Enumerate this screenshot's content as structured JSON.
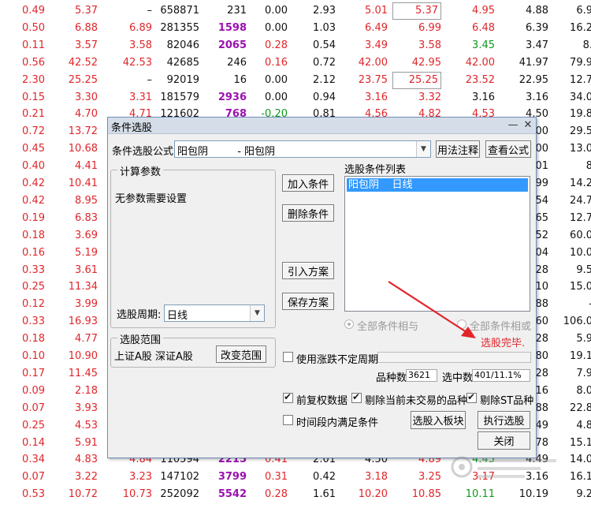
{
  "stock_rows": [
    [
      "0.49",
      "5.37",
      "–",
      "658871",
      "231",
      "0.00",
      "2.93",
      "5.01",
      "5.37",
      "4.95",
      "4.88",
      "6.9"
    ],
    [
      "0.50",
      "6.88",
      "6.89",
      "281355",
      "1598",
      "0.00",
      "1.03",
      "6.49",
      "6.99",
      "6.48",
      "6.39",
      "16.2"
    ],
    [
      "0.11",
      "3.57",
      "3.58",
      "82046",
      "2065",
      "0.28",
      "0.54",
      "3.49",
      "3.58",
      "3.45",
      "3.47",
      "8."
    ],
    [
      "0.56",
      "42.52",
      "42.53",
      "42685",
      "246",
      "0.16",
      "0.72",
      "42.00",
      "42.95",
      "42.00",
      "41.97",
      "79.9"
    ],
    [
      "2.30",
      "25.25",
      "–",
      "92019",
      "16",
      "0.00",
      "2.12",
      "23.75",
      "25.25",
      "23.52",
      "22.95",
      "12.7"
    ],
    [
      "0.15",
      "3.30",
      "3.31",
      "181579",
      "2936",
      "0.00",
      "0.94",
      "3.16",
      "3.32",
      "3.16",
      "3.16",
      "34.0"
    ],
    [
      "0.21",
      "4.70",
      "4.71",
      "121602",
      "768",
      "-0.20",
      "0.81",
      "4.56",
      "4.82",
      "4.53",
      "4.50",
      "19.8"
    ],
    [
      "0.72",
      "13.72",
      "",
      "",
      "",
      "",
      "",
      "",
      "",
      "",
      "00",
      "29.5"
    ],
    [
      "0.45",
      "10.68",
      "",
      "",
      "",
      "",
      "",
      "",
      "",
      "",
      "00",
      "13.0"
    ],
    [
      "0.40",
      "4.41",
      "",
      "",
      "",
      "",
      "",
      "",
      "",
      "",
      "01",
      "8"
    ],
    [
      "0.42",
      "10.41",
      "",
      "",
      "",
      "",
      "",
      "",
      "",
      "",
      "99",
      "14.2"
    ],
    [
      "0.42",
      "8.95",
      "",
      "",
      "",
      "",
      "",
      "",
      "",
      "",
      "54",
      "24.7"
    ],
    [
      "0.19",
      "6.83",
      "",
      "",
      "",
      "",
      "",
      "",
      "",
      "",
      "65",
      "12.7"
    ],
    [
      "0.18",
      "3.69",
      "",
      "",
      "",
      "",
      "",
      "",
      "",
      "",
      "52",
      "60.0"
    ],
    [
      "0.16",
      "5.19",
      "",
      "",
      "",
      "",
      "",
      "",
      "",
      "",
      "04",
      "10.0"
    ],
    [
      "0.33",
      "3.61",
      "",
      "",
      "",
      "",
      "",
      "",
      "",
      "",
      "28",
      "9.5"
    ],
    [
      "0.25",
      "11.34",
      "",
      "",
      "",
      "",
      "",
      "",
      "",
      "",
      "10",
      "15.0"
    ],
    [
      "0.12",
      "3.99",
      "",
      "",
      "",
      "",
      "",
      "",
      "",
      "",
      "88",
      "-"
    ],
    [
      "0.33",
      "16.93",
      "",
      "",
      "",
      "",
      "",
      "",
      "",
      "",
      "60",
      "106.0"
    ],
    [
      "0.18",
      "4.77",
      "",
      "",
      "",
      "",
      "",
      "",
      "",
      "",
      "28",
      "5.9"
    ],
    [
      "0.10",
      "10.90",
      "",
      "",
      "",
      "",
      "",
      "",
      "",
      "",
      "80",
      "19.1"
    ],
    [
      "0.17",
      "11.45",
      "",
      "",
      "",
      "",
      "",
      "",
      "",
      "",
      "28",
      "7.9"
    ],
    [
      "0.09",
      "2.18",
      "",
      "",
      "",
      "",
      "",
      "",
      "",
      "",
      "16",
      "8.0"
    ],
    [
      "0.07",
      "3.93",
      "",
      "",
      "",
      "",
      "",
      "",
      "",
      "",
      "88",
      "22.8"
    ],
    [
      "0.25",
      "4.53",
      "",
      "",
      "",
      "",
      "",
      "",
      "",
      "",
      "49",
      "4.8"
    ],
    [
      "0.14",
      "5.91",
      "",
      "",
      "",
      "",
      "",
      "",
      "",
      "",
      "78",
      "15.1"
    ],
    [
      "0.34",
      "4.83",
      "4.84",
      "110594",
      "2215",
      "0.41",
      "2.01",
      "4.50",
      "4.89",
      "4.45",
      "4.49",
      "14.0"
    ],
    [
      "0.07",
      "3.22",
      "3.23",
      "147102",
      "3799",
      "0.31",
      "0.42",
      "3.18",
      "3.25",
      "3.17",
      "3.16",
      "16.1"
    ],
    [
      "0.53",
      "10.72",
      "10.73",
      "252092",
      "5542",
      "0.28",
      "1.61",
      "10.20",
      "10.85",
      "10.11",
      "10.19",
      "9.2"
    ]
  ],
  "stock_colors": [
    [
      "red",
      "red",
      "black",
      "black",
      "black",
      "black",
      "black",
      "red",
      "red",
      "red",
      "black",
      "black"
    ],
    [
      "red",
      "red",
      "red",
      "black",
      "purple",
      "black",
      "black",
      "red",
      "red",
      "red",
      "black",
      "black"
    ],
    [
      "red",
      "red",
      "red",
      "black",
      "purple",
      "red",
      "black",
      "red",
      "red",
      "green",
      "black",
      "black"
    ],
    [
      "red",
      "red",
      "red",
      "black",
      "black",
      "red",
      "black",
      "red",
      "red",
      "red",
      "black",
      "black"
    ],
    [
      "red",
      "red",
      "black",
      "black",
      "black",
      "black",
      "black",
      "red",
      "red",
      "red",
      "black",
      "black"
    ],
    [
      "red",
      "red",
      "red",
      "black",
      "purple",
      "black",
      "black",
      "red",
      "red",
      "black",
      "black",
      "black"
    ],
    [
      "red",
      "red",
      "red",
      "black",
      "purple",
      "green",
      "black",
      "red",
      "red",
      "red",
      "black",
      "black"
    ],
    [
      "red",
      "red",
      "red",
      "black",
      "black",
      "black",
      "black",
      "black",
      "black",
      "black",
      "black",
      "black"
    ],
    [
      "red",
      "red",
      "red",
      "black",
      "black",
      "black",
      "black",
      "black",
      "black",
      "black",
      "black",
      "black"
    ],
    [
      "red",
      "red",
      "red",
      "black",
      "black",
      "black",
      "black",
      "black",
      "black",
      "black",
      "black",
      "black"
    ],
    [
      "red",
      "red",
      "red",
      "black",
      "black",
      "black",
      "black",
      "black",
      "black",
      "black",
      "black",
      "black"
    ],
    [
      "red",
      "red",
      "red",
      "black",
      "black",
      "black",
      "black",
      "black",
      "black",
      "black",
      "black",
      "black"
    ],
    [
      "red",
      "red",
      "red",
      "black",
      "black",
      "black",
      "black",
      "black",
      "black",
      "black",
      "black",
      "black"
    ],
    [
      "red",
      "red",
      "red",
      "black",
      "black",
      "black",
      "black",
      "black",
      "black",
      "black",
      "black",
      "black"
    ],
    [
      "red",
      "red",
      "red",
      "black",
      "black",
      "black",
      "black",
      "black",
      "black",
      "black",
      "black",
      "black"
    ],
    [
      "red",
      "red",
      "red",
      "black",
      "black",
      "black",
      "black",
      "black",
      "black",
      "black",
      "black",
      "black"
    ],
    [
      "red",
      "red",
      "red",
      "black",
      "black",
      "black",
      "black",
      "black",
      "black",
      "black",
      "black",
      "black"
    ],
    [
      "red",
      "red",
      "red",
      "black",
      "black",
      "black",
      "black",
      "black",
      "black",
      "black",
      "black",
      "black"
    ],
    [
      "red",
      "red",
      "red",
      "black",
      "black",
      "black",
      "black",
      "black",
      "black",
      "black",
      "black",
      "black"
    ],
    [
      "red",
      "red",
      "red",
      "black",
      "black",
      "black",
      "black",
      "black",
      "black",
      "black",
      "black",
      "black"
    ],
    [
      "red",
      "red",
      "red",
      "black",
      "black",
      "black",
      "black",
      "black",
      "black",
      "black",
      "black",
      "black"
    ],
    [
      "red",
      "red",
      "red",
      "black",
      "black",
      "black",
      "black",
      "black",
      "black",
      "black",
      "black",
      "black"
    ],
    [
      "red",
      "red",
      "red",
      "black",
      "black",
      "black",
      "black",
      "black",
      "black",
      "black",
      "black",
      "black"
    ],
    [
      "red",
      "red",
      "red",
      "black",
      "black",
      "black",
      "black",
      "black",
      "black",
      "black",
      "black",
      "black"
    ],
    [
      "red",
      "red",
      "red",
      "black",
      "black",
      "black",
      "black",
      "black",
      "black",
      "black",
      "black",
      "black"
    ],
    [
      "red",
      "red",
      "red",
      "black",
      "black",
      "black",
      "black",
      "black",
      "black",
      "black",
      "black",
      "black"
    ],
    [
      "red",
      "red",
      "red",
      "black",
      "purple",
      "red",
      "black",
      "black",
      "red",
      "green",
      "black",
      "black"
    ],
    [
      "red",
      "red",
      "red",
      "black",
      "purple",
      "red",
      "black",
      "red",
      "red",
      "red",
      "black",
      "black"
    ],
    [
      "red",
      "red",
      "red",
      "black",
      "purple",
      "red",
      "black",
      "red",
      "red",
      "green",
      "black",
      "black"
    ]
  ],
  "dialog": {
    "title": "条件选股",
    "help_icon": "help-icon",
    "close_icon": "close-icon",
    "formula_label": "条件选股公式",
    "formula_value": "阳包阴         - 阳包阴",
    "usage_button": "用法注释",
    "view_formula_button": "查看公式",
    "calc_params_title": "计算参数",
    "no_params_text": "无参数需要设置",
    "period_label": "选股周期:",
    "period_value": "日线",
    "add_condition_button": "加入条件",
    "delete_condition_button": "删除条件",
    "import_plan_button": "引入方案",
    "save_plan_button": "保存方案",
    "condition_list_label": "选股条件列表",
    "condition_items": [
      "阳包阴    日线"
    ],
    "radio_all_and": "全部条件相与",
    "radio_all_or": "全部条件相或",
    "done_text": "选股完毕.",
    "scope_title": "选股范围",
    "scope_value": "上证A股 深证A股",
    "change_scope_button": "改变范围",
    "use_limit_period": "使用涨跌不定周期",
    "variety_count_label": "品种数",
    "variety_count_value": "3621",
    "selected_label": "选中数",
    "selected_value": "401/11.1%",
    "forward_adjust": "前复权数据",
    "exclude_untraded": "剔除当前未交易的品种",
    "exclude_st": "剔除ST品种",
    "time_range_satisfy": "时间段内满足条件",
    "select_into_block_button": "选股入板块",
    "execute_button": "执行选股",
    "close_button": "关闭",
    "checks": {
      "use_limit_period": false,
      "forward_adjust": true,
      "exclude_untraded": true,
      "exclude_st": true,
      "time_range_satisfy": false
    }
  },
  "colors": {
    "up": "#e0262b",
    "down": "#0f9a1d",
    "volume": "#9b11b0",
    "selection": "#3399ff",
    "arrow": "#e0262b"
  }
}
